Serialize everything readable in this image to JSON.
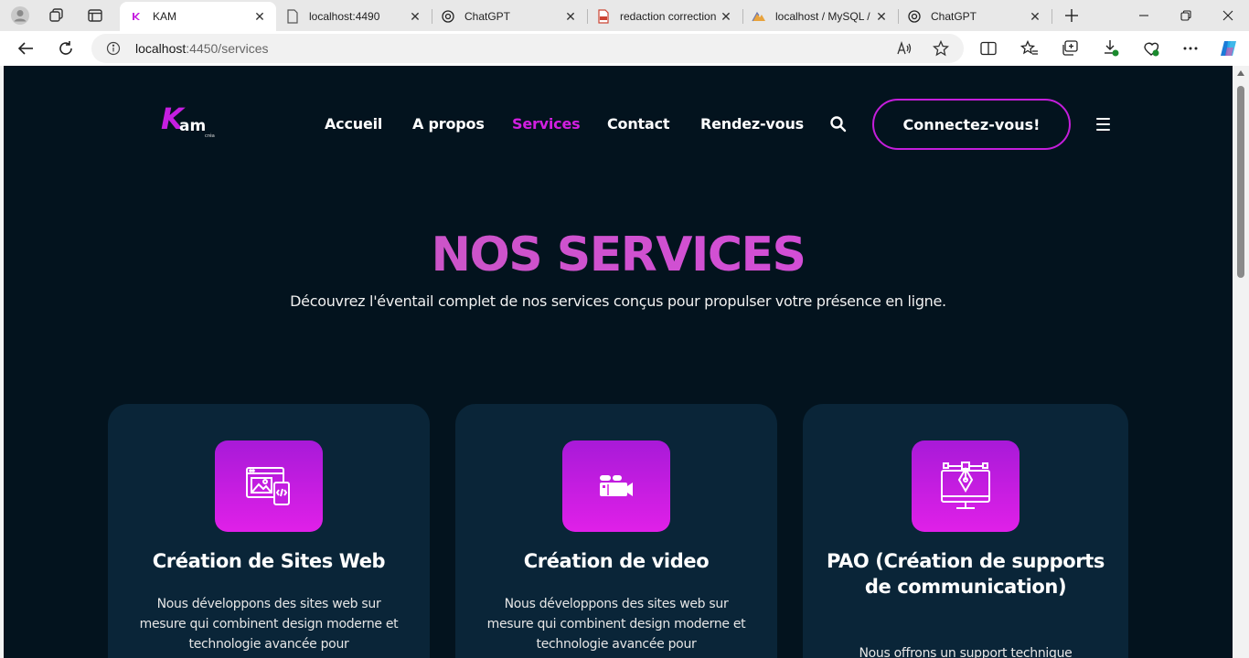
{
  "browser": {
    "tabs": [
      {
        "label": "KAM",
        "active": true,
        "icon": "kam-favicon"
      },
      {
        "label": "localhost:4490",
        "active": false,
        "icon": "page-icon"
      },
      {
        "label": "ChatGPT",
        "active": false,
        "icon": "chatgpt-icon"
      },
      {
        "label": "redaction correction",
        "active": false,
        "icon": "pdf-icon"
      },
      {
        "label": "localhost / MySQL /",
        "active": false,
        "icon": "phpmyadmin-icon"
      },
      {
        "label": "ChatGPT",
        "active": false,
        "icon": "chatgpt-icon"
      }
    ],
    "url_host": "localhost",
    "url_rest": ":4450/services"
  },
  "site": {
    "logo_k": "K",
    "logo_am": "am",
    "logo_crea": "créa",
    "nav": [
      "Accueil",
      "A propos",
      "Services",
      "Contact",
      "Rendez-vous"
    ],
    "active_nav": "Services",
    "connect_label": "Connectez-vous!",
    "accent_color": "#d21fe0"
  },
  "hero": {
    "title": "NOS SERVICES",
    "subtitle": "Découvrez l'éventail complet de nos services conçus pour propulser votre présence en ligne."
  },
  "services": [
    {
      "title": "Création de Sites Web",
      "description": "Nous développons des sites web sur mesure qui combinent design moderne et technologie avancée pour",
      "icon": "web-design-icon"
    },
    {
      "title": "Création de video",
      "description": "Nous développons des sites web sur mesure qui combinent design moderne et technologie avancée pour",
      "icon": "video-camera-icon"
    },
    {
      "title": "PAO (Création de supports de communication)",
      "description": "Nous offrons un support technique",
      "icon": "graphic-design-icon"
    }
  ]
}
